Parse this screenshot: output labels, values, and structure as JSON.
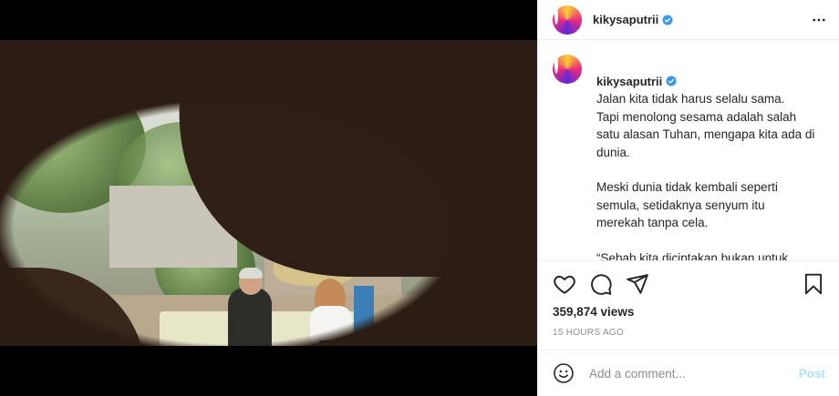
{
  "post": {
    "username": "kikysaputrii",
    "verified": true
  },
  "caption": {
    "username": "kikysaputrii",
    "paragraphs": [
      "Jalan kita tidak harus selalu sama.\nTapi menolong sesama adalah salah satu alasan Tuhan, mengapa kita ada di dunia.",
      "Meski dunia tidak kembali seperti semula, setidaknya senyum itu merekah tanpa cela.",
      "“Sebab kita diciptakan bukan untuk"
    ]
  },
  "stats": {
    "views": "359,874 views",
    "time_ago": "15 HOURS AGO"
  },
  "comment": {
    "placeholder": "Add a comment...",
    "post_label": "Post"
  },
  "icons": {
    "more": "more-options-icon",
    "like": "heart-icon",
    "comment": "comment-icon",
    "share": "share-icon",
    "save": "bookmark-icon",
    "emoji": "emoji-icon",
    "mute": "speaker-icon",
    "verified": "verified-badge-icon"
  },
  "colors": {
    "verified": "#3897f0",
    "post_button_disabled": "#b2dffc",
    "muted_text": "#8e8e8e"
  }
}
